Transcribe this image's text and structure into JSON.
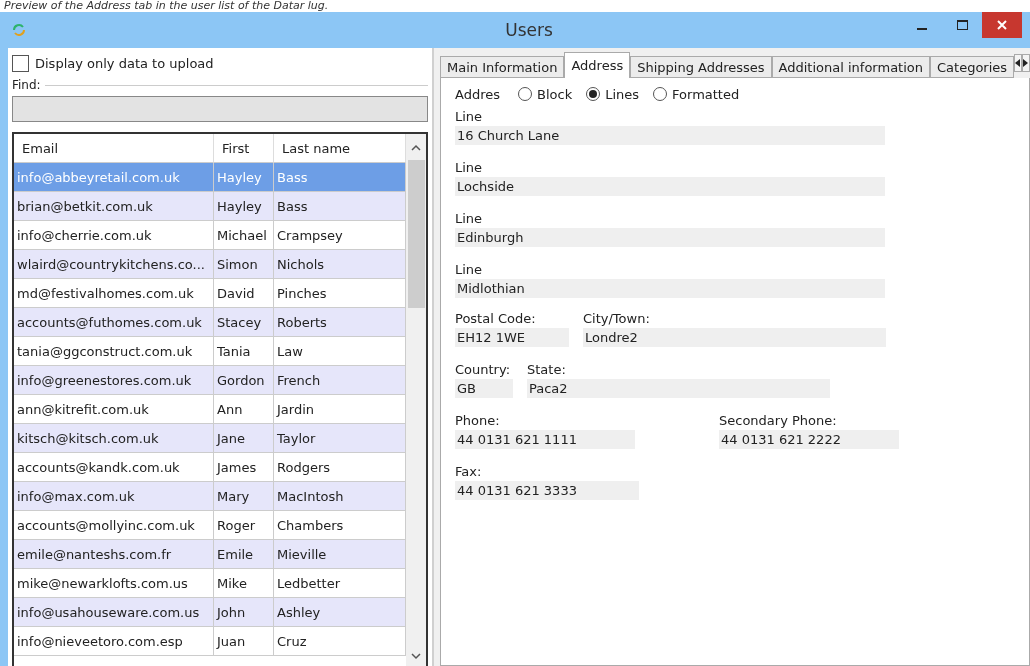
{
  "caption": "Preview of the Address tab in the user list of the Datar lug.",
  "window": {
    "title": "Users"
  },
  "filter": {
    "label": "Display only data to upload",
    "checked": false
  },
  "find": {
    "label": "Find:"
  },
  "table": {
    "columns": [
      "Email",
      "First",
      "Last name"
    ],
    "rows": [
      {
        "cells": [
          "info@abbeyretail.com.uk",
          "Hayley",
          "Bass"
        ],
        "selected": true
      },
      {
        "cells": [
          "brian@betkit.com.uk",
          "Hayley",
          "Bass"
        ],
        "selected": false
      },
      {
        "cells": [
          "info@cherrie.com.uk",
          "Michael",
          "Crampsey"
        ],
        "selected": false
      },
      {
        "cells": [
          "wlaird@countrykitchens.co...",
          "Simon",
          "Nichols"
        ],
        "selected": false
      },
      {
        "cells": [
          "md@festivalhomes.com.uk",
          "David",
          "Pinches"
        ],
        "selected": false
      },
      {
        "cells": [
          "accounts@futhomes.com.uk",
          "Stacey",
          "Roberts"
        ],
        "selected": false
      },
      {
        "cells": [
          "tania@ggconstruct.com.uk",
          "Tania",
          "Law"
        ],
        "selected": false
      },
      {
        "cells": [
          "info@greenestores.com.uk",
          "Gordon",
          "French"
        ],
        "selected": false
      },
      {
        "cells": [
          "ann@kitrefit.com.uk",
          "Ann",
          "Jardin"
        ],
        "selected": false
      },
      {
        "cells": [
          "kitsch@kitsch.com.uk",
          "Jane",
          "Taylor"
        ],
        "selected": false
      },
      {
        "cells": [
          "accounts@kandk.com.uk",
          "James",
          "Rodgers"
        ],
        "selected": false
      },
      {
        "cells": [
          "info@max.com.uk",
          "Mary",
          "MacIntosh"
        ],
        "selected": false
      },
      {
        "cells": [
          "accounts@mollyinc.com.uk",
          "Roger",
          "Chambers"
        ],
        "selected": false
      },
      {
        "cells": [
          "emile@nanteshs.com.fr",
          "Emile",
          "Mieville"
        ],
        "selected": false
      },
      {
        "cells": [
          "mike@newarklofts.com.us",
          "Mike",
          "Ledbetter"
        ],
        "selected": false
      },
      {
        "cells": [
          "info@usahouseware.com.us",
          "John",
          "Ashley"
        ],
        "selected": false
      },
      {
        "cells": [
          "info@nieveetoro.com.esp",
          "Juan",
          "Cruz"
        ],
        "selected": false
      }
    ]
  },
  "tabs": [
    {
      "label": "Main Information",
      "selected": false
    },
    {
      "label": "Address",
      "selected": true
    },
    {
      "label": "Shipping Addresses",
      "selected": false
    },
    {
      "label": "Additional information",
      "selected": false
    },
    {
      "label": "Categories",
      "selected": false
    }
  ],
  "address_mode": {
    "label": "Addres",
    "options": [
      {
        "label": "Block",
        "selected": false
      },
      {
        "label": "Lines",
        "selected": true
      },
      {
        "label": "Formatted",
        "selected": false
      }
    ]
  },
  "lines": [
    {
      "label": "Line",
      "value": "16 Church Lane"
    },
    {
      "label": "Line",
      "value": "Lochside"
    },
    {
      "label": "Line",
      "value": "Edinburgh"
    },
    {
      "label": "Line",
      "value": "Midlothian"
    }
  ],
  "postal_code": {
    "label": "Postal Code:",
    "value": "EH12 1WE"
  },
  "city": {
    "label": "City/Town:",
    "value": "Londre2"
  },
  "country": {
    "label": "Country:",
    "value": "GB"
  },
  "state": {
    "label": "State:",
    "value": "Paca2"
  },
  "phone": {
    "label": "Phone:",
    "value": "44 0131 621 1111"
  },
  "secondary_phone": {
    "label": "Secondary Phone:",
    "value": "44 0131 621 2222"
  },
  "fax": {
    "label": "Fax:",
    "value": "44 0131 621 3333"
  }
}
